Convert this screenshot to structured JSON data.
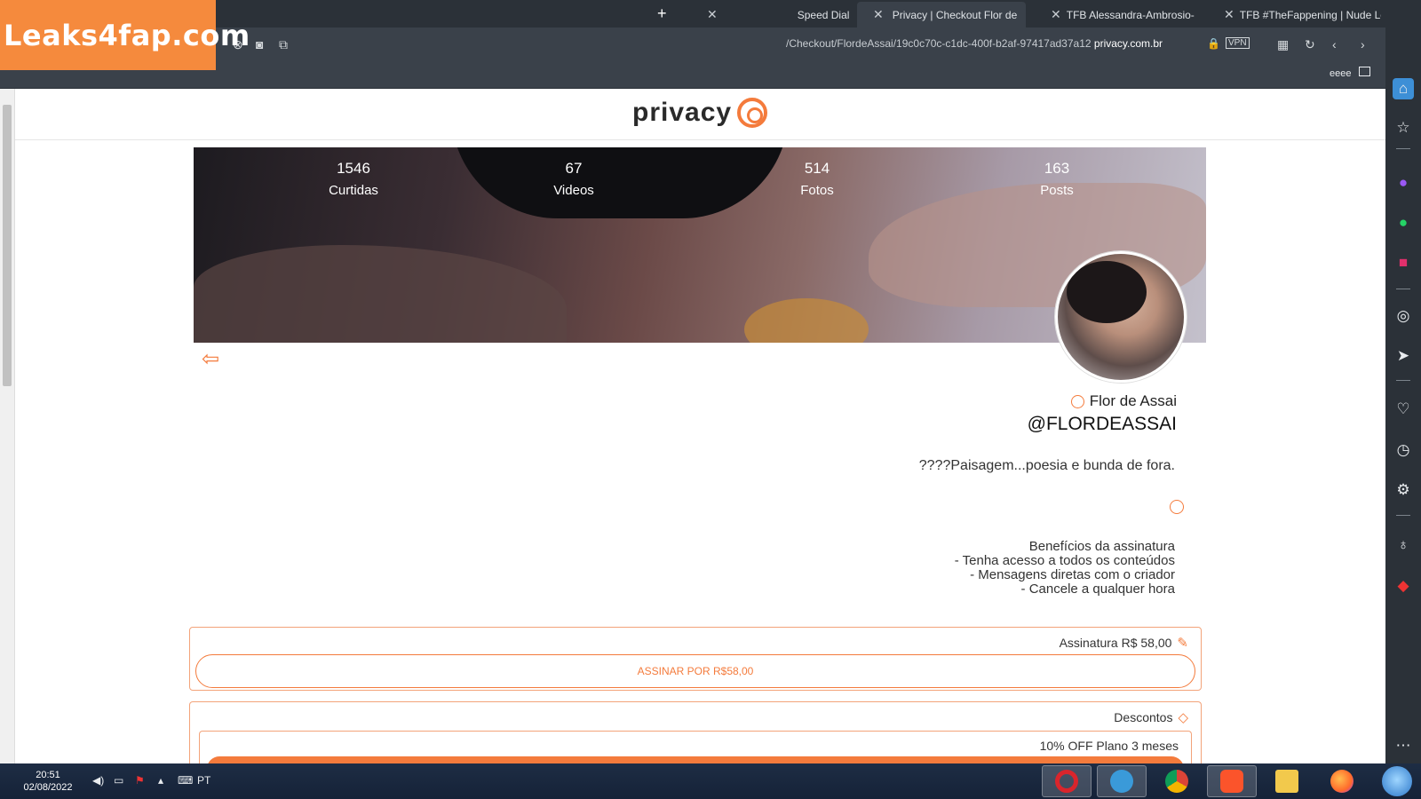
{
  "watermark": {
    "text": "Leaks4fap.com"
  },
  "browser": {
    "tabs": [
      {
        "label": "TFB #TheFappening | Nude Le",
        "active": false
      },
      {
        "label": "TFB Alessandra-Ambrosio-Sex",
        "active": false
      },
      {
        "label": "Privacy | Checkout Flor de",
        "active": true
      },
      {
        "label": "Speed Dial",
        "active": false
      }
    ],
    "new_tab_glyph": "+",
    "url_domain": "privacy.com.br",
    "url_path": "/Checkout/FlordeAssai/19c0c70c-c1dc-400f-b2af-97417ad37a12",
    "vpn_label": "VPN",
    "bookmark_label": "eeee"
  },
  "site": {
    "logo_text": "privacy",
    "stats": [
      {
        "num": "1546",
        "label": "Curtidas"
      },
      {
        "num": "67",
        "label": "Videos"
      },
      {
        "num": "514",
        "label": "Fotos"
      },
      {
        "num": "163",
        "label": "Posts"
      }
    ],
    "profile": {
      "name": "Flor de Assai",
      "handle": "@FLORDEASSAI",
      "bio": "????Paisagem...poesia e bunda de fora."
    },
    "benefits": {
      "title": "Benefícios da assinatura",
      "items": [
        "- Tenha acesso a todos os conteúdos",
        "- Mensagens diretas com o criador",
        "- Cancele a qualquer hora"
      ]
    },
    "subscription": {
      "title": "Assinatura R$ 58,00",
      "button_label": "ASSINAR POR R$58,00"
    },
    "discounts": {
      "title": "Descontos",
      "plan_title": "10% OFF Plano 3 meses"
    }
  },
  "taskbar": {
    "time": "20:51",
    "date": "02/08/2022",
    "lang": "PT"
  },
  "colors": {
    "brand": "#f47b3c",
    "chrome": "#2b3138",
    "watermark": "#f58a3d"
  }
}
